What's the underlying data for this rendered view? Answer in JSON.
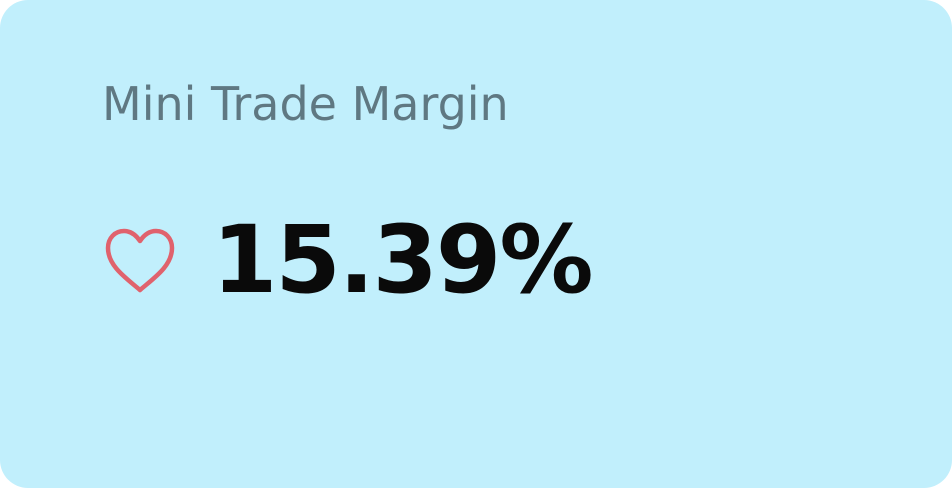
{
  "card": {
    "title": "Mini Trade Margin",
    "value": "15.39%",
    "icon": "heart-outline-icon",
    "colors": {
      "background": "#c1effc",
      "title": "#5f7882",
      "value": "#0a0a0a",
      "icon": "#e0626d"
    }
  }
}
